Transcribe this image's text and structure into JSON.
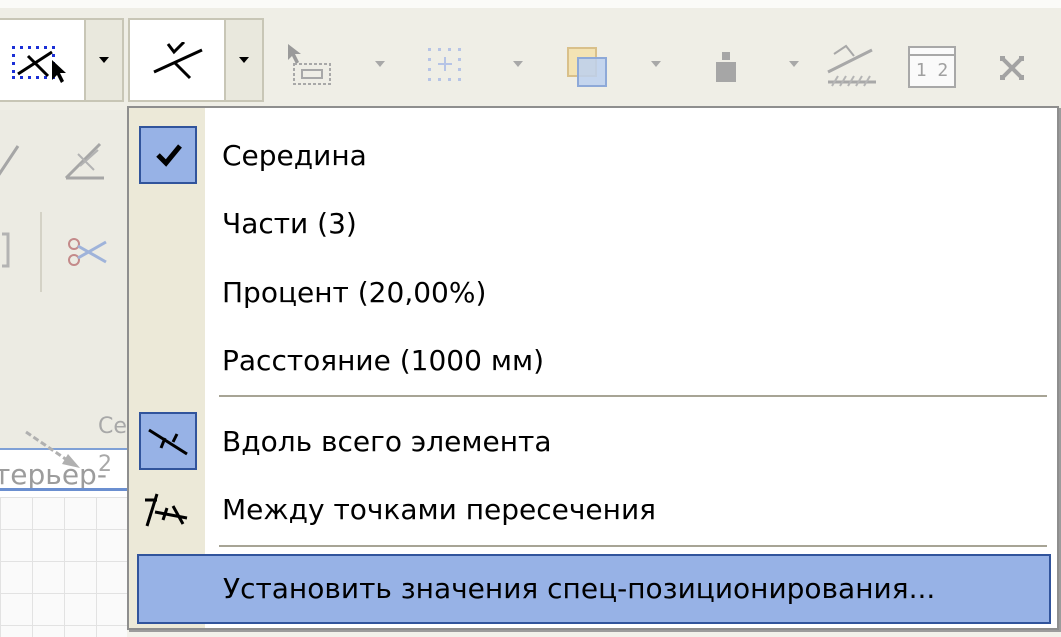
{
  "toolbar": {
    "buttons": [
      {
        "icon": "snap-point-pointer-icon",
        "has_dropdown": true,
        "active": true
      },
      {
        "icon": "special-snap-midpoint-icon",
        "has_dropdown": true,
        "active": true
      },
      {
        "icon": "cursor-select-icon",
        "has_dropdown": true,
        "active": false
      },
      {
        "icon": "grid-snap-icon",
        "has_dropdown": true,
        "active": false
      },
      {
        "icon": "layers-overlap-icon",
        "has_dropdown": true,
        "active": false
      },
      {
        "icon": "pin-icon",
        "has_dropdown": true,
        "active": false
      },
      {
        "icon": "surface-hatch-icon",
        "has_dropdown": false,
        "active": false
      },
      {
        "icon": "ruler-measure-icon",
        "has_dropdown": false,
        "active": false
      },
      {
        "icon": "close-icon",
        "has_dropdown": false,
        "active": false
      }
    ],
    "ruler_label": "1 2"
  },
  "background": {
    "layer_field": "терьер-",
    "partial_label_top": "Се",
    "partial_label_bottom": "2"
  },
  "menu": {
    "items": [
      {
        "label": "Середина",
        "checked": true,
        "icon": "checkmark-icon"
      },
      {
        "label": "Части (3)",
        "checked": false
      },
      {
        "label": "Процент (20,00%)",
        "checked": false
      },
      {
        "label": "Расстояние (1000 мм)",
        "checked": false
      }
    ],
    "items2": [
      {
        "label": "Вдоль всего элемента",
        "checked": true,
        "icon": "along-element-icon"
      },
      {
        "label": "Между точками пересечения",
        "checked": false,
        "icon": "between-intersections-icon"
      }
    ],
    "action": {
      "label": "Установить значения спец-позиционирования...",
      "highlighted": true
    }
  },
  "colors": {
    "highlight": "#97b2e6",
    "highlight_border": "#31549c",
    "gutter": "#ece9d8"
  }
}
